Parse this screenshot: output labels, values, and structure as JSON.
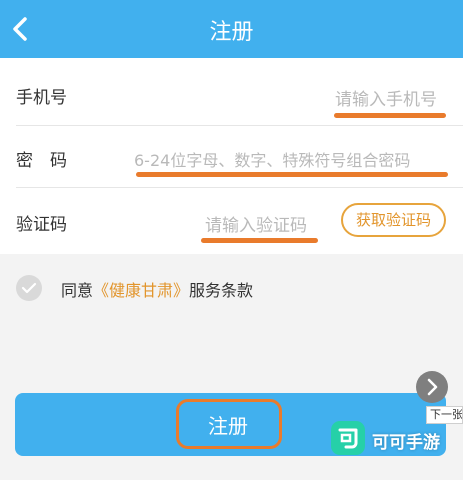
{
  "header": {
    "title": "注册"
  },
  "form": {
    "phone": {
      "label": "手机号",
      "placeholder": "请输入手机号"
    },
    "password": {
      "label": "密　码",
      "placeholder": "6-24位字母、数字、特殊符号组合密码"
    },
    "code": {
      "label": "验证码",
      "placeholder": "请输入验证码",
      "button": "获取验证码"
    }
  },
  "agreement": {
    "prefix": "同意",
    "link": "《健康甘肃》",
    "suffix": "服务条款"
  },
  "submit": {
    "label": "注册"
  },
  "overlay": {
    "next_tip": "下一张"
  },
  "watermark": {
    "text": "可可手游"
  },
  "colors": {
    "header_bg": "#41b0ee",
    "accent_orange": "#e97b2c",
    "link_orange": "#e2952c",
    "button_blue": "#41b0ee"
  }
}
